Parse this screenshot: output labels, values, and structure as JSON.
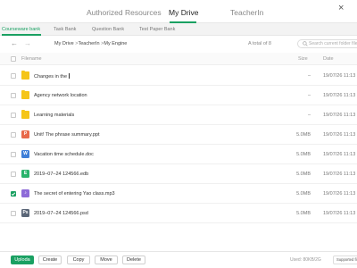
{
  "top_tabs": {
    "authorized": "Authorized Resources",
    "my_drive": "My Drive",
    "teacherin": "TeacherIn",
    "close_glyph": "×"
  },
  "sub_tabs": {
    "courseware": "Courseware bank",
    "task": "Task Bank",
    "question": "Question Bank",
    "test_paper": "Test Paper Bank"
  },
  "nav": {
    "back_glyph": "←",
    "forward_glyph": "→",
    "breadcrumb": [
      "My Drive",
      "TeacherIn",
      "My Engine"
    ],
    "separator": ">",
    "total": "A total of 8",
    "search_placeholder": "Search current folder file"
  },
  "table": {
    "headers": {
      "filename": "Filename",
      "size": "Size",
      "date": "Date"
    },
    "rows": [
      {
        "type": "folder",
        "name": "Changes in the ",
        "size": "–",
        "time": "19/07/26 11:13",
        "checked": false,
        "editing": true
      },
      {
        "type": "folder",
        "name": "Agency network location",
        "size": "–",
        "time": "19/07/26 11:13",
        "checked": false
      },
      {
        "type": "folder",
        "name": "Learning materials",
        "size": "–",
        "time": "19/07/26 11:13",
        "checked": false
      },
      {
        "type": "ppt",
        "icon_letter": "P",
        "icon_color": "#e8694a",
        "name": "Unit! The phrase summary.ppt",
        "size": "5.0MB",
        "time": "19/07/26 11:13",
        "checked": false
      },
      {
        "type": "doc",
        "icon_letter": "W",
        "icon_color": "#3f7fd8",
        "name": "Vacation time schedule.doc",
        "size": "5.0MB",
        "time": "19/07/26 11:13",
        "checked": false
      },
      {
        "type": "edb",
        "icon_letter": "E",
        "icon_color": "#29b36b",
        "name": "2019–07–24 124566.edb",
        "size": "5.0MB",
        "time": "19/07/26 11:13",
        "checked": false
      },
      {
        "type": "mp3",
        "icon_letter": "♪",
        "icon_color": "#8e6bd8",
        "name": "The secret of entering Yao class.mp3",
        "size": "5.0MB",
        "time": "19/07/26 11:13",
        "checked": true
      },
      {
        "type": "psd",
        "icon_letter": "Ps",
        "icon_color": "#5a6677",
        "name": "2019–07–24 124566.psd",
        "size": "5.0MB",
        "time": "19/07/26 11:13",
        "checked": false
      }
    ]
  },
  "bottom": {
    "upload": "Uploda",
    "create": "Create",
    "copy": "Copy",
    "move": "Move",
    "delete": "Delete",
    "used": "Used: 80KB/2G",
    "supported": "Supported file format"
  },
  "colors": {
    "accent": "#1aa062",
    "folder": "#f5c518"
  }
}
